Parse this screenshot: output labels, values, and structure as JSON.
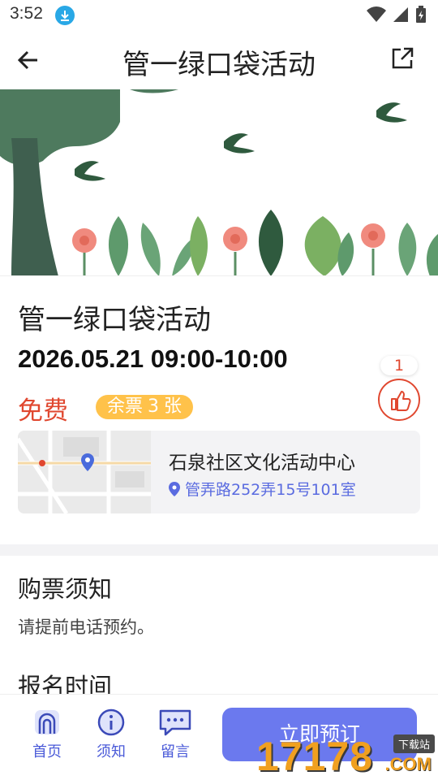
{
  "status_bar": {
    "time": "3:52"
  },
  "header": {
    "title": "管一绿口袋活动"
  },
  "event": {
    "name": "管一绿口袋活动",
    "time": "2026.05.21 09:00-10:00",
    "price": "免费",
    "ticket_prefix": "余票",
    "ticket_count": "3",
    "ticket_suffix": "张",
    "like_count": "1"
  },
  "venue": {
    "name": "石泉社区文化活动中心",
    "address": "管弄路252弄15号101室"
  },
  "sections": {
    "notice_title": "购票须知",
    "notice_text": "请提前电话预约。",
    "signup_title": "报名时间"
  },
  "bottom_nav": {
    "items": [
      {
        "label": "首页",
        "icon": "home-icon"
      },
      {
        "label": "须知",
        "icon": "info-icon"
      },
      {
        "label": "留言",
        "icon": "message-icon"
      }
    ],
    "book_label": "立即预订"
  },
  "watermark": {
    "text": "17178",
    "suffix": ".COM",
    "badge": "下载站"
  },
  "colors": {
    "accent": "#6b79ee",
    "price_red": "#e0472f",
    "ticket_badge": "#ffc24a",
    "address_blue": "#5a6be0"
  }
}
